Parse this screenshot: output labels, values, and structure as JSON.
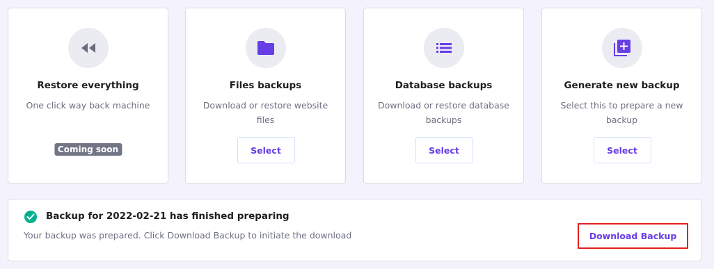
{
  "cards": [
    {
      "icon": "rewind-icon",
      "title": "Restore everything",
      "description": "One click way back machine",
      "badge": "Coming soon"
    },
    {
      "icon": "folder-icon",
      "title": "Files backups",
      "description": "Download or restore website files",
      "button_label": "Select"
    },
    {
      "icon": "list-icon",
      "title": "Database backups",
      "description": "Download or restore database backups",
      "button_label": "Select"
    },
    {
      "icon": "add-backup-icon",
      "title": "Generate new backup",
      "description": "Select this to prepare a new backup",
      "button_label": "Select"
    }
  ],
  "notice": {
    "icon": "check-circle-icon",
    "title": "Backup for 2022-02-21 has finished preparing",
    "message": "Your backup was prepared. Click Download Backup to initiate the download",
    "button_label": "Download Backup"
  },
  "colors": {
    "accent": "#673de6",
    "success": "#00b090",
    "highlight_border": "#e51e1e",
    "page_background": "#f4f3fd"
  }
}
